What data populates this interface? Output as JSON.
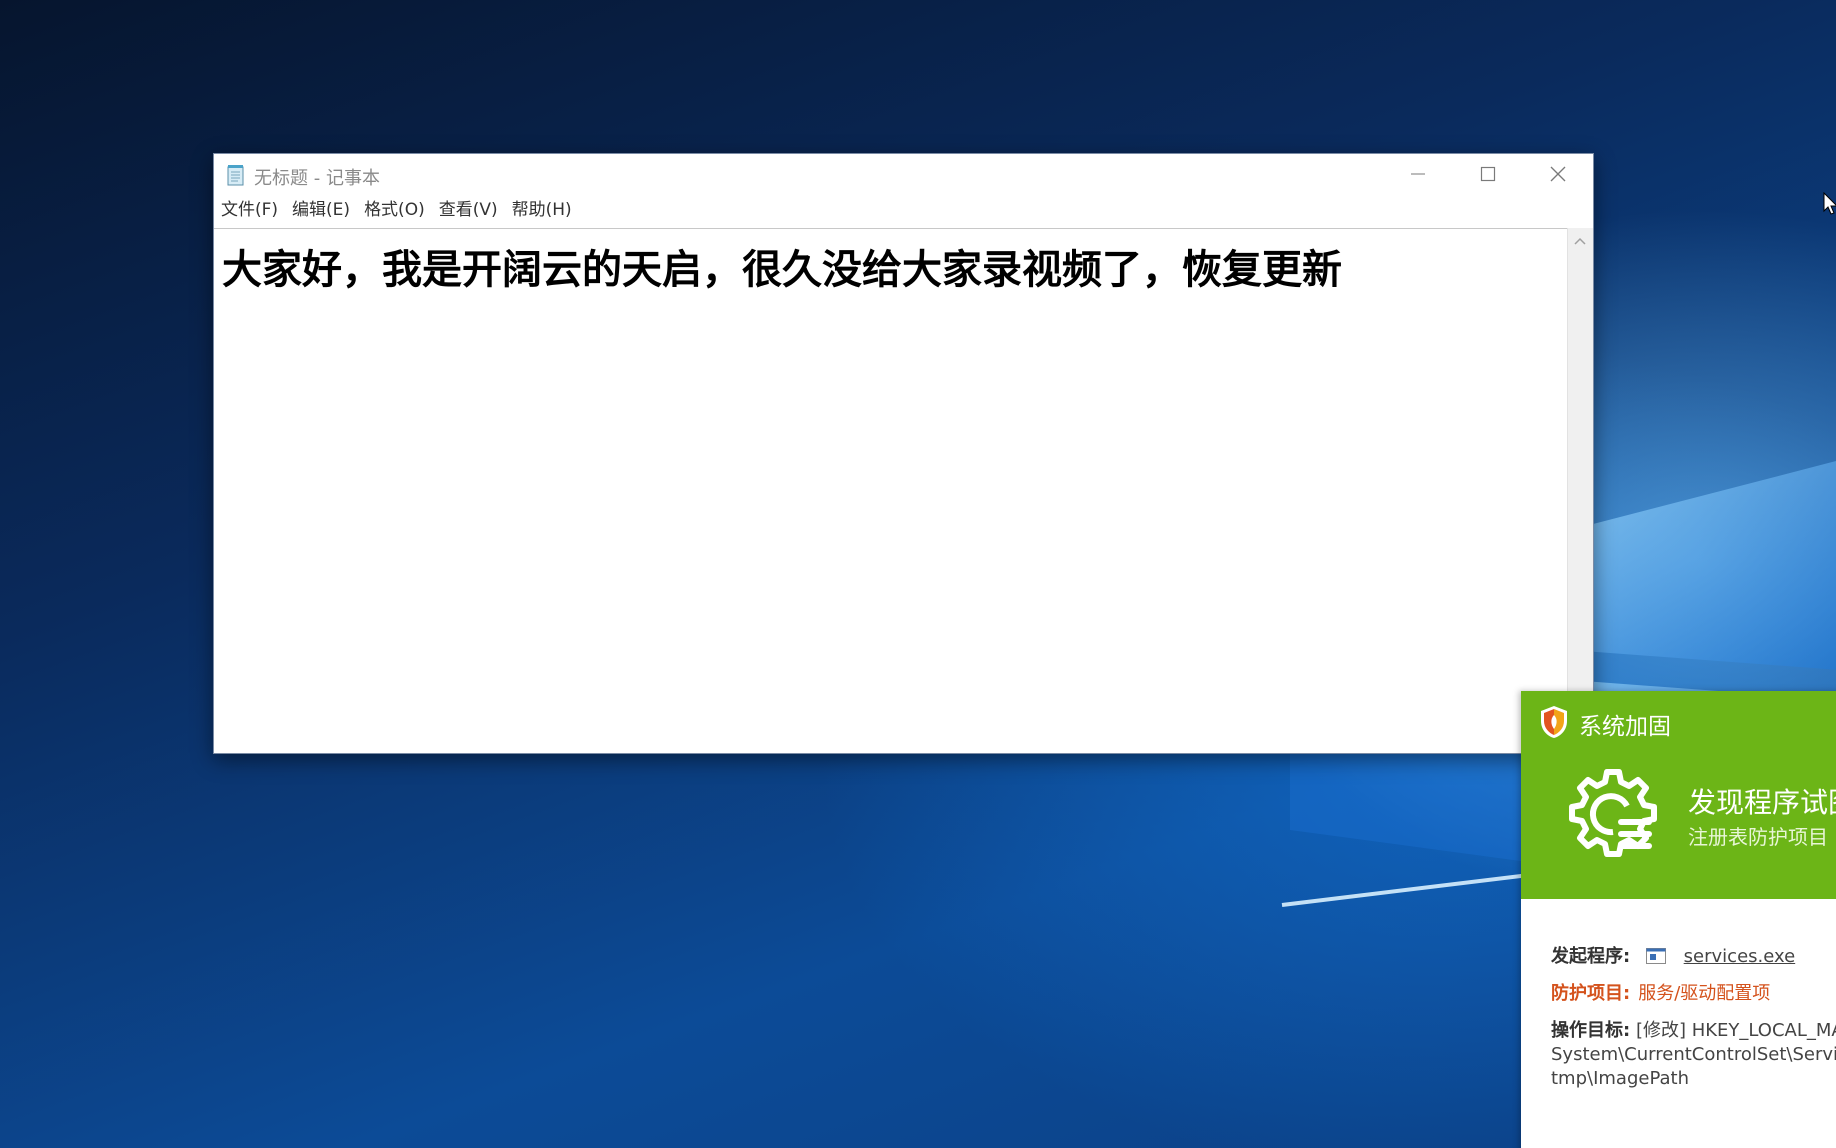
{
  "notepad": {
    "title": "无标题 - 记事本",
    "menu": [
      {
        "label": "文件(F)"
      },
      {
        "label": "编辑(E)"
      },
      {
        "label": "格式(O)"
      },
      {
        "label": "查看(V)"
      },
      {
        "label": "帮助(H)"
      }
    ],
    "content": "大家好，我是开阔云的天启，很久没给大家录视频了，恢复更新"
  },
  "popup": {
    "title": "系统加固",
    "headline": "发现程序试图",
    "subline": "注册表防护项目",
    "initiator_label": "发起程序:",
    "initiator_value": "services.exe",
    "protect_label": "防护项目:",
    "protect_value": "服务/驱动配置项",
    "target_label": "操作目标:",
    "target_lines": [
      "[修改] HKEY_LOCAL_MA",
      "System\\CurrentControlSet\\Service",
      "tmp\\ImagePath"
    ],
    "accent_color": "#6cb517"
  },
  "icons": {
    "notepad": "notepad-icon",
    "minimize": "minimize-icon",
    "maximize": "maximize-icon",
    "close": "close-icon",
    "shield": "shield-icon",
    "gear": "gear-icon",
    "exe": "exe-icon",
    "cursor": "mouse-cursor-icon"
  }
}
